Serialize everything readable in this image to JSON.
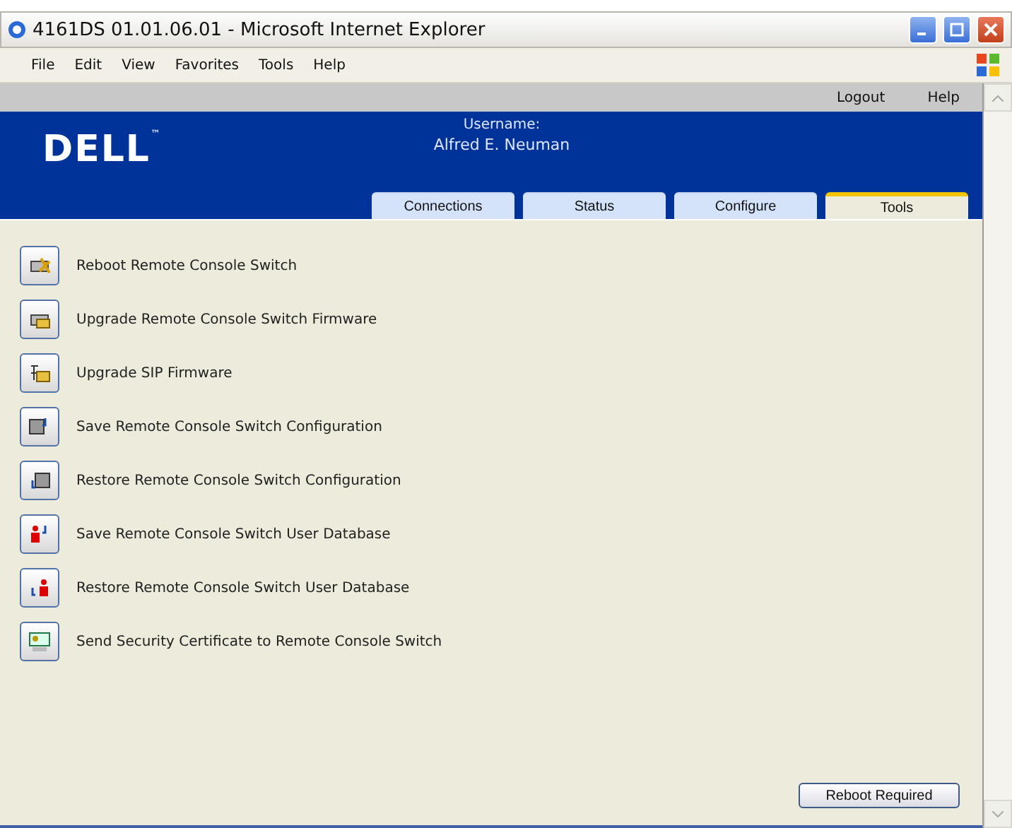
{
  "window": {
    "title": "4161DS 01.01.06.01 - Microsoft Internet Explorer"
  },
  "menu": [
    "File",
    "Edit",
    "View",
    "Favorites",
    "Tools",
    "Help"
  ],
  "top_links": [
    "Logout",
    "Help"
  ],
  "logo": {
    "text": "DELL",
    "mark": "™"
  },
  "user": {
    "label": "Username:",
    "name": "Alfred E. Neuman"
  },
  "tabs": [
    {
      "label": "Connections",
      "selected": false
    },
    {
      "label": "Status",
      "selected": false
    },
    {
      "label": "Configure",
      "selected": false
    },
    {
      "label": "Tools",
      "selected": true
    }
  ],
  "actions": [
    {
      "label": "Reboot Remote Console Switch",
      "kind": "reboot"
    },
    {
      "label": "Upgrade Remote Console Switch Firmware",
      "kind": "upgrade"
    },
    {
      "label": "Upgrade SIP Firmware",
      "kind": "sip"
    },
    {
      "label": "Save Remote Console Switch Configuration",
      "kind": "save"
    },
    {
      "label": "Restore Remote Console Switch Configuration",
      "kind": "restore"
    },
    {
      "label": "Save Remote Console Switch User Database",
      "kind": "saveuser"
    },
    {
      "label": "Restore Remote Console Switch User Database",
      "kind": "restoreuser"
    },
    {
      "label": "Send Security Certificate to Remote Console Switch",
      "kind": "cert"
    }
  ],
  "footer_button": "Reboot Required"
}
